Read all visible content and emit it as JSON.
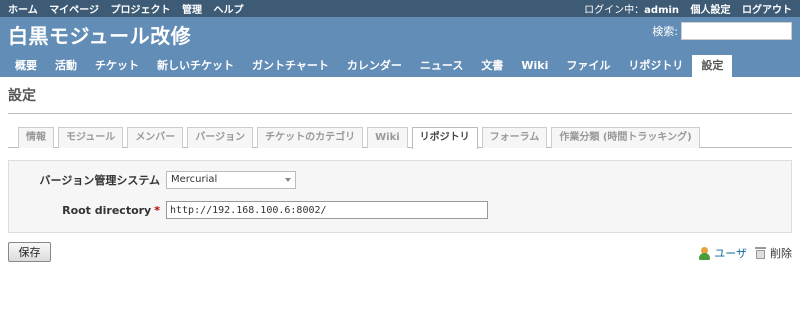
{
  "top_menu": {
    "left": [
      "ホーム",
      "マイページ",
      "プロジェクト",
      "管理",
      "ヘルプ"
    ],
    "logged_as_prefix": "ログイン中：",
    "user": "admin",
    "right": [
      "個人設定",
      "ログアウト"
    ]
  },
  "header": {
    "title": "白黒モジュール改修",
    "search_label": "検索:",
    "search_value": ""
  },
  "main_menu": [
    "概要",
    "活動",
    "チケット",
    "新しいチケット",
    "ガントチャート",
    "カレンダー",
    "ニュース",
    "文書",
    "Wiki",
    "ファイル",
    "リポジトリ",
    "設定"
  ],
  "main_menu_selected": "設定",
  "page_title": "設定",
  "tabs": [
    "情報",
    "モジュール",
    "メンバー",
    "バージョン",
    "チケットのカテゴリ",
    "Wiki",
    "リポジトリ",
    "フォーラム",
    "作業分類 (時間トラッキング)"
  ],
  "tabs_selected": "リポジトリ",
  "form": {
    "scm_label": "バージョン管理システム",
    "scm_value": "Mercurial",
    "root_label": "Root directory",
    "required_mark": "*",
    "root_value": "http://192.168.100.6:8002/"
  },
  "actions": {
    "save": "保存",
    "users": "ユーザ",
    "delete": "削除"
  }
}
